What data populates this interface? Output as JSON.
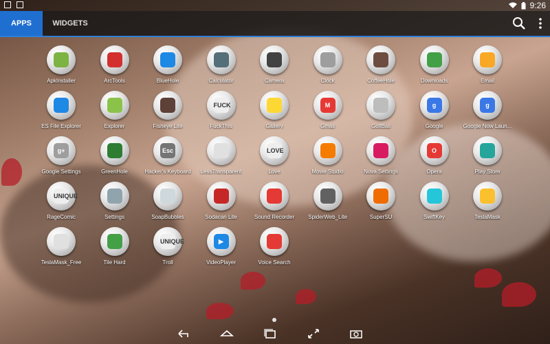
{
  "status": {
    "time": "9:26"
  },
  "tabs": [
    {
      "label": "APPS"
    },
    {
      "label": "WIDGETS"
    }
  ],
  "apps": [
    {
      "name": "ApkInstaller",
      "icon": "android-icon",
      "color": "#7cb342",
      "glyph": ""
    },
    {
      "name": "ArcTools",
      "icon": "tools-icon",
      "color": "#d32f2f",
      "glyph": ""
    },
    {
      "name": "BlueHole",
      "icon": "bluehole-icon",
      "color": "#1e88e5",
      "glyph": ""
    },
    {
      "name": "Calculator",
      "icon": "calculator-icon",
      "color": "#546e7a",
      "glyph": ""
    },
    {
      "name": "Camera",
      "icon": "camera-icon",
      "color": "#424242",
      "glyph": ""
    },
    {
      "name": "Clock",
      "icon": "clock-icon",
      "color": "#9e9e9e",
      "glyph": ""
    },
    {
      "name": "CoffeeHole",
      "icon": "coffeehole-icon",
      "color": "#6d4c41",
      "glyph": ""
    },
    {
      "name": "Downloads",
      "icon": "download-icon",
      "color": "#43a047",
      "glyph": ""
    },
    {
      "name": "Email",
      "icon": "email-icon",
      "color": "#f9a825",
      "glyph": ""
    },
    {
      "name": "ES File Explorer",
      "icon": "folder-icon",
      "color": "#1e88e5",
      "glyph": ""
    },
    {
      "name": "Explorer",
      "icon": "explorer-icon",
      "color": "#8bc34a",
      "glyph": ""
    },
    {
      "name": "Fisheye Lite",
      "icon": "fisheye-icon",
      "color": "#5d4037",
      "glyph": ""
    },
    {
      "name": "FuckThis",
      "icon": "text-icon",
      "color": "#eeeeee",
      "glyph": "FUCK"
    },
    {
      "name": "Gallery",
      "icon": "gallery-icon",
      "color": "#fdd835",
      "glyph": ""
    },
    {
      "name": "Gmail",
      "icon": "gmail-icon",
      "color": "#e53935",
      "glyph": "M"
    },
    {
      "name": "GolfBall",
      "icon": "golfball-icon",
      "color": "#bdbdbd",
      "glyph": ""
    },
    {
      "name": "Google",
      "icon": "google-icon",
      "color": "#3b78e7",
      "glyph": "g"
    },
    {
      "name": "Google Now Laun...",
      "icon": "google-now-icon",
      "color": "#3b78e7",
      "glyph": "g"
    },
    {
      "name": "Google Settings",
      "icon": "google-settings-icon",
      "color": "#9e9e9e",
      "glyph": "g+"
    },
    {
      "name": "GreenHole",
      "icon": "greenhole-icon",
      "color": "#2e7d32",
      "glyph": ""
    },
    {
      "name": "Hacker's Keyboard",
      "icon": "keyboard-icon",
      "color": "#757575",
      "glyph": "Esc"
    },
    {
      "name": "LessTransparent",
      "icon": "transparent-icon",
      "color": "#e0e0e0",
      "glyph": ""
    },
    {
      "name": "Love",
      "icon": "love-icon",
      "color": "#eeeeee",
      "glyph": "LOVE"
    },
    {
      "name": "Movie Studio",
      "icon": "movie-icon",
      "color": "#f57c00",
      "glyph": ""
    },
    {
      "name": "Nova Settings",
      "icon": "nova-icon",
      "color": "#d81b60",
      "glyph": ""
    },
    {
      "name": "Opera",
      "icon": "opera-icon",
      "color": "#e53935",
      "glyph": "O"
    },
    {
      "name": "Play Store",
      "icon": "play-store-icon",
      "color": "#26a69a",
      "glyph": ""
    },
    {
      "name": "RageComic",
      "icon": "ragecomic-icon",
      "color": "#eeeeee",
      "glyph": "UNIQUE"
    },
    {
      "name": "Settings",
      "icon": "settings-icon",
      "color": "#90a4ae",
      "glyph": ""
    },
    {
      "name": "SoapBubbles",
      "icon": "bubbles-icon",
      "color": "#cfd8dc",
      "glyph": ""
    },
    {
      "name": "Sodacan Lite",
      "icon": "sodacan-icon",
      "color": "#c62828",
      "glyph": ""
    },
    {
      "name": "Sound Recorder",
      "icon": "microphone-icon",
      "color": "#e53935",
      "glyph": ""
    },
    {
      "name": "SpiderWeb_Lite",
      "icon": "spiderweb-icon",
      "color": "#616161",
      "glyph": ""
    },
    {
      "name": "SuperSU",
      "icon": "supersu-icon",
      "color": "#ef6c00",
      "glyph": ""
    },
    {
      "name": "SwiftKey",
      "icon": "swiftkey-icon",
      "color": "#26c6da",
      "glyph": ""
    },
    {
      "name": "TeslaMask",
      "icon": "teslamask-icon",
      "color": "#fbc02d",
      "glyph": ""
    },
    {
      "name": "TeslaMask_Free",
      "icon": "teslamask-free-icon",
      "color": "#e0e0e0",
      "glyph": ""
    },
    {
      "name": "Tile Hard",
      "icon": "tile-icon",
      "color": "#43a047",
      "glyph": ""
    },
    {
      "name": "Troll",
      "icon": "troll-icon",
      "color": "#eeeeee",
      "glyph": "UNIQUE"
    },
    {
      "name": "VideoPlayer",
      "icon": "video-icon",
      "color": "#1e88e5",
      "glyph": "▶"
    },
    {
      "name": "Voice Search",
      "icon": "voice-icon",
      "color": "#e53935",
      "glyph": ""
    }
  ]
}
